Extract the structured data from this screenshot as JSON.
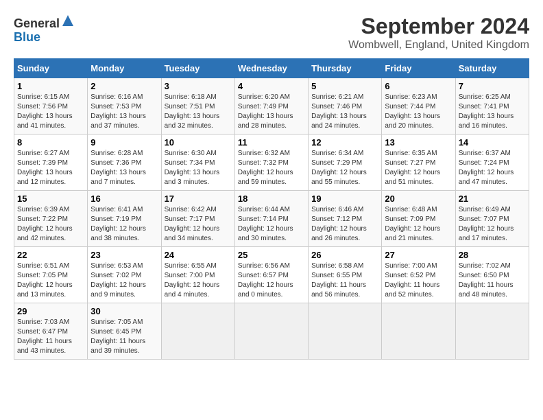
{
  "header": {
    "logo_line1": "General",
    "logo_line2": "Blue",
    "title": "September 2024",
    "subtitle": "Wombwell, England, United Kingdom"
  },
  "calendar": {
    "weekdays": [
      "Sunday",
      "Monday",
      "Tuesday",
      "Wednesday",
      "Thursday",
      "Friday",
      "Saturday"
    ],
    "weeks": [
      [
        {
          "day": "",
          "detail": ""
        },
        {
          "day": "2",
          "detail": "Sunrise: 6:16 AM\nSunset: 7:53 PM\nDaylight: 13 hours\nand 37 minutes."
        },
        {
          "day": "3",
          "detail": "Sunrise: 6:18 AM\nSunset: 7:51 PM\nDaylight: 13 hours\nand 32 minutes."
        },
        {
          "day": "4",
          "detail": "Sunrise: 6:20 AM\nSunset: 7:49 PM\nDaylight: 13 hours\nand 28 minutes."
        },
        {
          "day": "5",
          "detail": "Sunrise: 6:21 AM\nSunset: 7:46 PM\nDaylight: 13 hours\nand 24 minutes."
        },
        {
          "day": "6",
          "detail": "Sunrise: 6:23 AM\nSunset: 7:44 PM\nDaylight: 13 hours\nand 20 minutes."
        },
        {
          "day": "7",
          "detail": "Sunrise: 6:25 AM\nSunset: 7:41 PM\nDaylight: 13 hours\nand 16 minutes."
        }
      ],
      [
        {
          "day": "8",
          "detail": "Sunrise: 6:27 AM\nSunset: 7:39 PM\nDaylight: 13 hours\nand 12 minutes."
        },
        {
          "day": "9",
          "detail": "Sunrise: 6:28 AM\nSunset: 7:36 PM\nDaylight: 13 hours\nand 7 minutes."
        },
        {
          "day": "10",
          "detail": "Sunrise: 6:30 AM\nSunset: 7:34 PM\nDaylight: 13 hours\nand 3 minutes."
        },
        {
          "day": "11",
          "detail": "Sunrise: 6:32 AM\nSunset: 7:32 PM\nDaylight: 12 hours\nand 59 minutes."
        },
        {
          "day": "12",
          "detail": "Sunrise: 6:34 AM\nSunset: 7:29 PM\nDaylight: 12 hours\nand 55 minutes."
        },
        {
          "day": "13",
          "detail": "Sunrise: 6:35 AM\nSunset: 7:27 PM\nDaylight: 12 hours\nand 51 minutes."
        },
        {
          "day": "14",
          "detail": "Sunrise: 6:37 AM\nSunset: 7:24 PM\nDaylight: 12 hours\nand 47 minutes."
        }
      ],
      [
        {
          "day": "15",
          "detail": "Sunrise: 6:39 AM\nSunset: 7:22 PM\nDaylight: 12 hours\nand 42 minutes."
        },
        {
          "day": "16",
          "detail": "Sunrise: 6:41 AM\nSunset: 7:19 PM\nDaylight: 12 hours\nand 38 minutes."
        },
        {
          "day": "17",
          "detail": "Sunrise: 6:42 AM\nSunset: 7:17 PM\nDaylight: 12 hours\nand 34 minutes."
        },
        {
          "day": "18",
          "detail": "Sunrise: 6:44 AM\nSunset: 7:14 PM\nDaylight: 12 hours\nand 30 minutes."
        },
        {
          "day": "19",
          "detail": "Sunrise: 6:46 AM\nSunset: 7:12 PM\nDaylight: 12 hours\nand 26 minutes."
        },
        {
          "day": "20",
          "detail": "Sunrise: 6:48 AM\nSunset: 7:09 PM\nDaylight: 12 hours\nand 21 minutes."
        },
        {
          "day": "21",
          "detail": "Sunrise: 6:49 AM\nSunset: 7:07 PM\nDaylight: 12 hours\nand 17 minutes."
        }
      ],
      [
        {
          "day": "22",
          "detail": "Sunrise: 6:51 AM\nSunset: 7:05 PM\nDaylight: 12 hours\nand 13 minutes."
        },
        {
          "day": "23",
          "detail": "Sunrise: 6:53 AM\nSunset: 7:02 PM\nDaylight: 12 hours\nand 9 minutes."
        },
        {
          "day": "24",
          "detail": "Sunrise: 6:55 AM\nSunset: 7:00 PM\nDaylight: 12 hours\nand 4 minutes."
        },
        {
          "day": "25",
          "detail": "Sunrise: 6:56 AM\nSunset: 6:57 PM\nDaylight: 12 hours\nand 0 minutes."
        },
        {
          "day": "26",
          "detail": "Sunrise: 6:58 AM\nSunset: 6:55 PM\nDaylight: 11 hours\nand 56 minutes."
        },
        {
          "day": "27",
          "detail": "Sunrise: 7:00 AM\nSunset: 6:52 PM\nDaylight: 11 hours\nand 52 minutes."
        },
        {
          "day": "28",
          "detail": "Sunrise: 7:02 AM\nSunset: 6:50 PM\nDaylight: 11 hours\nand 48 minutes."
        }
      ],
      [
        {
          "day": "29",
          "detail": "Sunrise: 7:03 AM\nSunset: 6:47 PM\nDaylight: 11 hours\nand 43 minutes."
        },
        {
          "day": "30",
          "detail": "Sunrise: 7:05 AM\nSunset: 6:45 PM\nDaylight: 11 hours\nand 39 minutes."
        },
        {
          "day": "",
          "detail": ""
        },
        {
          "day": "",
          "detail": ""
        },
        {
          "day": "",
          "detail": ""
        },
        {
          "day": "",
          "detail": ""
        },
        {
          "day": "",
          "detail": ""
        }
      ]
    ],
    "day1": {
      "day": "1",
      "detail": "Sunrise: 6:15 AM\nSunset: 7:56 PM\nDaylight: 13 hours\nand 41 minutes."
    }
  }
}
